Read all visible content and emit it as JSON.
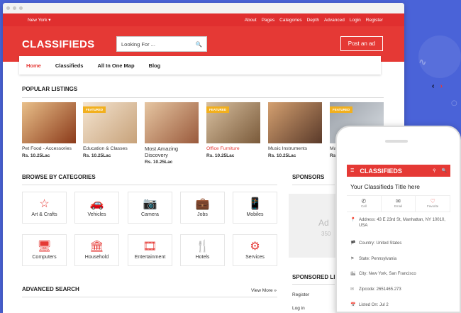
{
  "topnav": {
    "location": "New York",
    "links": [
      "About",
      "Pages",
      "Categories",
      "Depth",
      "Advanced",
      "Login",
      "Register"
    ]
  },
  "header": {
    "logo": "CLASSIFIEDS",
    "search_placeholder": "Looking For ...",
    "post_button": "Post an ad"
  },
  "mainnav": [
    "Home",
    "Classifieds",
    "All In One Map",
    "Blog"
  ],
  "popular": {
    "title": "POPULAR LISTINGS",
    "items": [
      {
        "title": "Pet Food - Accessories",
        "price": "Rs. 10.25Lac",
        "featured": false,
        "highlight": false
      },
      {
        "title": "Education & Classes",
        "price": "Rs. 10.25Lac",
        "featured": true,
        "highlight": false
      },
      {
        "title": "Most Amazing Discovery",
        "price": "Rs. 10.25Lac",
        "featured": false,
        "highlight": false
      },
      {
        "title": "Office Furniture",
        "price": "Rs. 10.25Lac",
        "featured": true,
        "highlight": true
      },
      {
        "title": "Music Instruments",
        "price": "Rs. 10.25Lac",
        "featured": false,
        "highlight": false
      },
      {
        "title": "Ma",
        "price": "Rs.",
        "featured": true,
        "highlight": false
      }
    ]
  },
  "categories": {
    "title": "BROWSE BY CATEGORIES",
    "items": [
      {
        "label": "Art & Crafts",
        "icon": "☆"
      },
      {
        "label": "Vehicles",
        "icon": "🚗"
      },
      {
        "label": "Camera",
        "icon": "📷"
      },
      {
        "label": "Jobs",
        "icon": "💼"
      },
      {
        "label": "Mobiles",
        "icon": "📱"
      },
      {
        "label": "Computers",
        "icon": "🖥"
      },
      {
        "label": "Household",
        "icon": "🏛"
      },
      {
        "label": "Entertainment",
        "icon": "🎞"
      },
      {
        "label": "Hotels",
        "icon": "🍴"
      },
      {
        "label": "Services",
        "icon": "⚙"
      }
    ]
  },
  "sponsors": {
    "title": "SPONSORS",
    "ad_text": "Ad",
    "ad_size": "350"
  },
  "sponsored_links": {
    "title": "SPONSORED LIN",
    "links": [
      "Register",
      "Log in"
    ]
  },
  "advanced": {
    "title": "ADVANCED SEARCH",
    "view_more": "View More »"
  },
  "phone": {
    "logo": "CLASSIFIEDS",
    "title": "Your Classifieds Title here",
    "actions": [
      "Call",
      "Email",
      "Favorite"
    ],
    "rows": [
      {
        "icon": "📍",
        "text": "Address: 43 E 23rd St, Manhattan, NY 10010, USA"
      },
      {
        "icon": "🏴",
        "text": "Country: United States"
      },
      {
        "icon": "⚑",
        "text": "State: Pennsylvania"
      },
      {
        "icon": "🏙",
        "text": "City: New York, San Francisco"
      },
      {
        "icon": "✉",
        "text": "Zipcode: 2651465.273"
      },
      {
        "icon": "📅",
        "text": "Listed On: Jul 2"
      }
    ]
  }
}
